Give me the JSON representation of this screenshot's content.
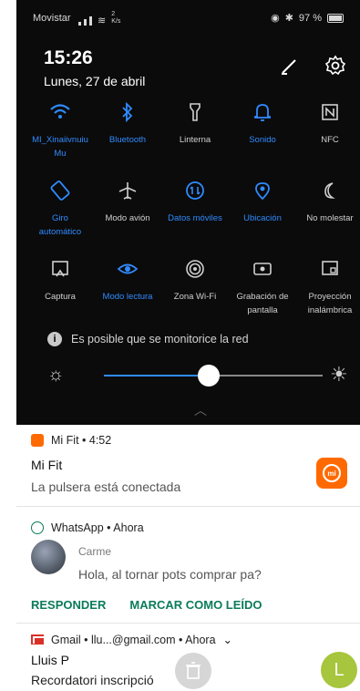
{
  "status": {
    "carrier": "Movistar",
    "speed": "2\nK/s",
    "battery": "97 %"
  },
  "header": {
    "time": "15:26",
    "date": "Lunes, 27 de abril"
  },
  "tiles": [
    {
      "label": "MI_Xinaiivnuiu\nMu",
      "icon": "wifi-icon",
      "active": true
    },
    {
      "label": "Bluetooth",
      "icon": "bluetooth-icon",
      "active": true
    },
    {
      "label": "Linterna",
      "icon": "flashlight-icon",
      "active": false
    },
    {
      "label": "Sonido",
      "icon": "bell-icon",
      "active": true
    },
    {
      "label": "NFC",
      "icon": "nfc-icon",
      "active": false
    },
    {
      "label": "Giro\nautomático",
      "icon": "rotate-icon",
      "active": true
    },
    {
      "label": "Modo avión",
      "icon": "airplane-icon",
      "active": false
    },
    {
      "label": "Datos móviles",
      "icon": "mobile-data-icon",
      "active": true
    },
    {
      "label": "Ubicación",
      "icon": "location-icon",
      "active": true
    },
    {
      "label": "No molestar",
      "icon": "moon-icon",
      "active": false
    },
    {
      "label": "Captura",
      "icon": "screenshot-icon",
      "active": false
    },
    {
      "label": "Modo lectura",
      "icon": "eye-icon",
      "active": true
    },
    {
      "label": "Zona Wi-Fi",
      "icon": "hotspot-icon",
      "active": false
    },
    {
      "label": "Grabación de\npantalla",
      "icon": "record-icon",
      "active": false
    },
    {
      "label": "Proyección\ninalámbrica",
      "icon": "cast-icon",
      "active": false
    }
  ],
  "notice": "Es posible que se monitorice la red",
  "brightness": {
    "level": 0.48
  },
  "mifit": {
    "app": "Mi Fit • 4:52",
    "title": "Mi Fit",
    "body": "La pulsera está conectada",
    "logo_text": "mi"
  },
  "whatsapp": {
    "app": "WhatsApp • Ahora",
    "sender": "Carme",
    "body": "Hola, al tornar pots comprar pa?",
    "reply": "RESPONDER",
    "mark_read": "MARCAR COMO LEÍDO"
  },
  "gmail": {
    "app": "Gmail • llu...@gmail.com • Ahora",
    "title": "Lluis P",
    "body": "Recordatori inscripció",
    "avatar_letter": "L"
  },
  "colors": {
    "accent": "#2f8bff",
    "whatsapp_action": "#0b7b5a",
    "mifit_orange": "#ff6a00"
  }
}
